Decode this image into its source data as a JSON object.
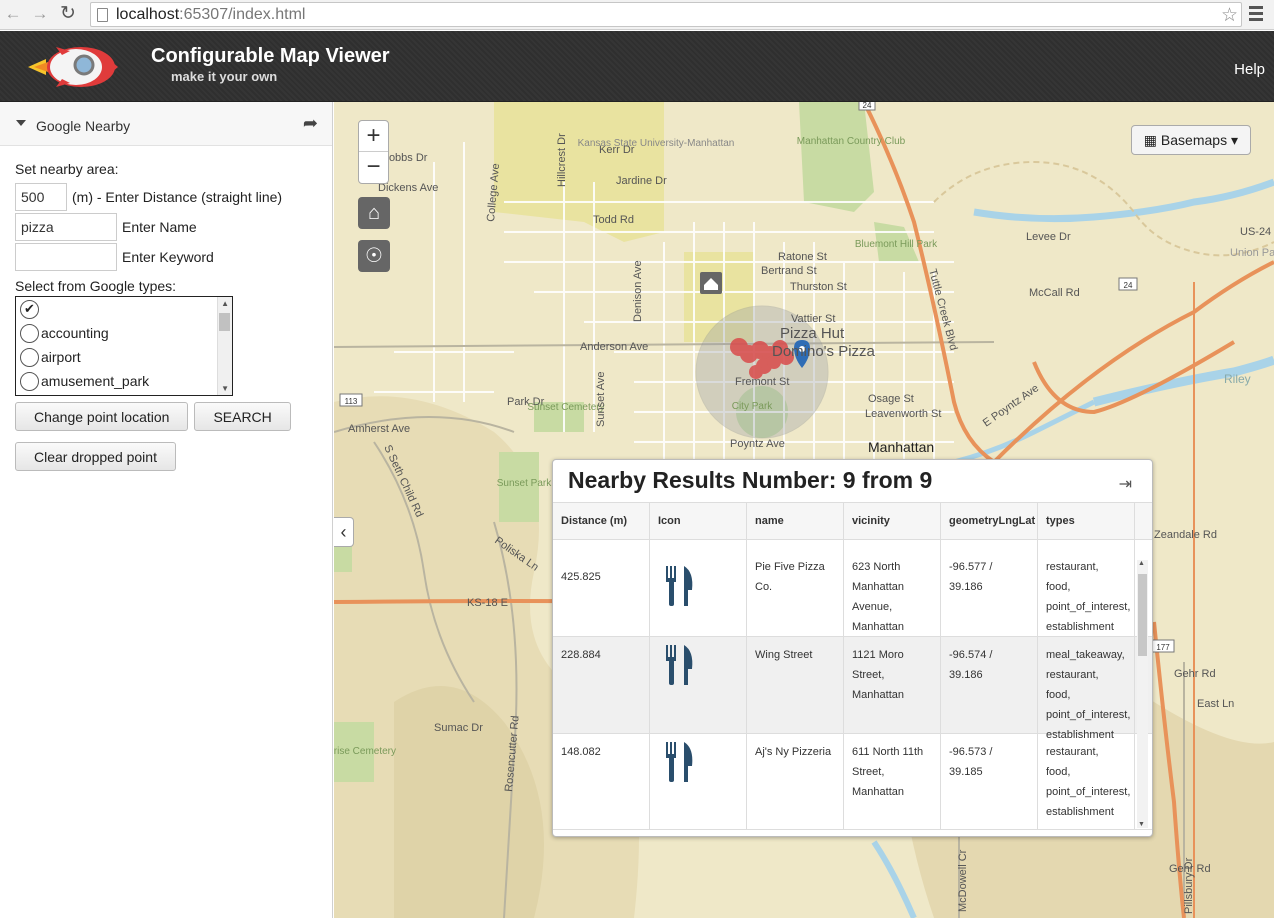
{
  "browser": {
    "url_host": "localhost",
    "url_rest": ":65307/index.html"
  },
  "header": {
    "title": "Configurable Map Viewer",
    "subtitle": "make it your own",
    "help": "Help"
  },
  "sidebar": {
    "panel_title": "Google Nearby",
    "set_area_label": "Set nearby area:",
    "distance_value": "500",
    "distance_label": "(m) - Enter Distance (straight line)",
    "name_value": "pizza",
    "name_label": "Enter Name",
    "keyword_value": "",
    "keyword_label": "Enter Keyword",
    "types_label": "Select from Google types:",
    "types": [
      "accounting",
      "airport",
      "amusement_park"
    ],
    "change_point_button": "Change point location",
    "search_button": "SEARCH",
    "clear_button": "Clear dropped point"
  },
  "map": {
    "zoom_in": "+",
    "zoom_out": "−",
    "basemaps_button": "Basemaps",
    "labels": {
      "kansas_state": "Kansas State University-Manhattan",
      "manhattan_cc": "Manhattan Country Club",
      "bluemont": "Bluemont Hill Park",
      "manhattan": "Manhattan",
      "pizza_hut": "Pizza Hut",
      "dominos": "Domino's Pizza",
      "sunset_cemetery": "Sunset Cemetery",
      "sunset_park": "Sunset Park",
      "city_park": "City Park",
      "sunrise_cemetery": "Sunrise Cemetery",
      "kerr": "Kerr Dr",
      "jardine": "Jardine Dr",
      "todd": "Todd Rd",
      "dickens": "Dickens Ave",
      "hobbs": "Hobbs Dr",
      "anderson": "Anderson Ave",
      "ratone": "Ratone St",
      "bertrand": "Bertrand St",
      "thurston": "Thurston St",
      "vattier": "Vattier St",
      "fremont": "Fremont St",
      "osage": "Osage St",
      "leavenworth": "Leavenworth St",
      "poyntz": "Poyntz Ave",
      "mccall": "McCall Rd",
      "levee": "Levee Dr",
      "zeandale": "Zeandale Rd",
      "ks18": "KS-18 E",
      "us24": "US-24 E",
      "union_pac": "Union Pac",
      "riley": "Riley",
      "sumac": "Sumac Dr",
      "amherst": "Amherst Ave",
      "park_dr": "Park Dr",
      "sunset_ave": "Sunset Ave",
      "denison": "Denison Ave",
      "college": "College Ave",
      "hillcrest": "Hillcrest Dr",
      "tuttle": "Tuttle Creek Blvd",
      "gehr": "Gehr Rd",
      "east_ln": "East Ln",
      "pillsbury": "Pillsbury Dr",
      "mcdowell": "McDowell Cr",
      "rosencutter": "Rosencutter Rd",
      "polisk": "Poliska Ln",
      "seth_child": "S Seth Child Rd",
      "e_poyntz": "E Poyntz Ave",
      "hwy24": "24",
      "hwy113": "113",
      "hwy177": "177"
    }
  },
  "results": {
    "title": "Nearby Results Number: 9 from 9",
    "columns": [
      "Distance (m)",
      "Icon",
      "name",
      "vicinity",
      "geometryLngLat",
      "types"
    ],
    "rows": [
      {
        "distance": "425.825",
        "icon": "restaurant-icon",
        "name": [
          "Pie Five Pizza",
          "Co."
        ],
        "vicinity": [
          "623 North",
          "Manhattan",
          "Avenue,",
          "Manhattan"
        ],
        "lnglat": "-96.577 / 39.186",
        "types": [
          "restaurant, food,",
          "point_of_interest,",
          "establishment"
        ]
      },
      {
        "distance": "228.884",
        "icon": "restaurant-icon",
        "name": [
          "Wing Street"
        ],
        "vicinity": [
          "1121 Moro",
          "Street,",
          "Manhattan"
        ],
        "lnglat": "-96.574 / 39.186",
        "types": [
          "meal_takeaway,",
          "restaurant, food,",
          "point_of_interest,",
          "establishment"
        ]
      },
      {
        "distance": "148.082",
        "icon": "restaurant-icon",
        "name": [
          "Aj's Ny Pizzeria"
        ],
        "vicinity": [
          "611 North 11th",
          "Street,",
          "Manhattan"
        ],
        "lnglat": "-96.573 / 39.185",
        "types": [
          "restaurant, food,",
          "point_of_interest,",
          "establishment"
        ]
      }
    ]
  },
  "colors": {
    "header_bg": "#2f2f2f",
    "map_bg": "#efe8c8",
    "highway": "#e8925a",
    "river": "#a9d3e8",
    "park": "#c8dba3",
    "marker_red": "#d94b4b",
    "marker_blue": "#2f6db5"
  }
}
